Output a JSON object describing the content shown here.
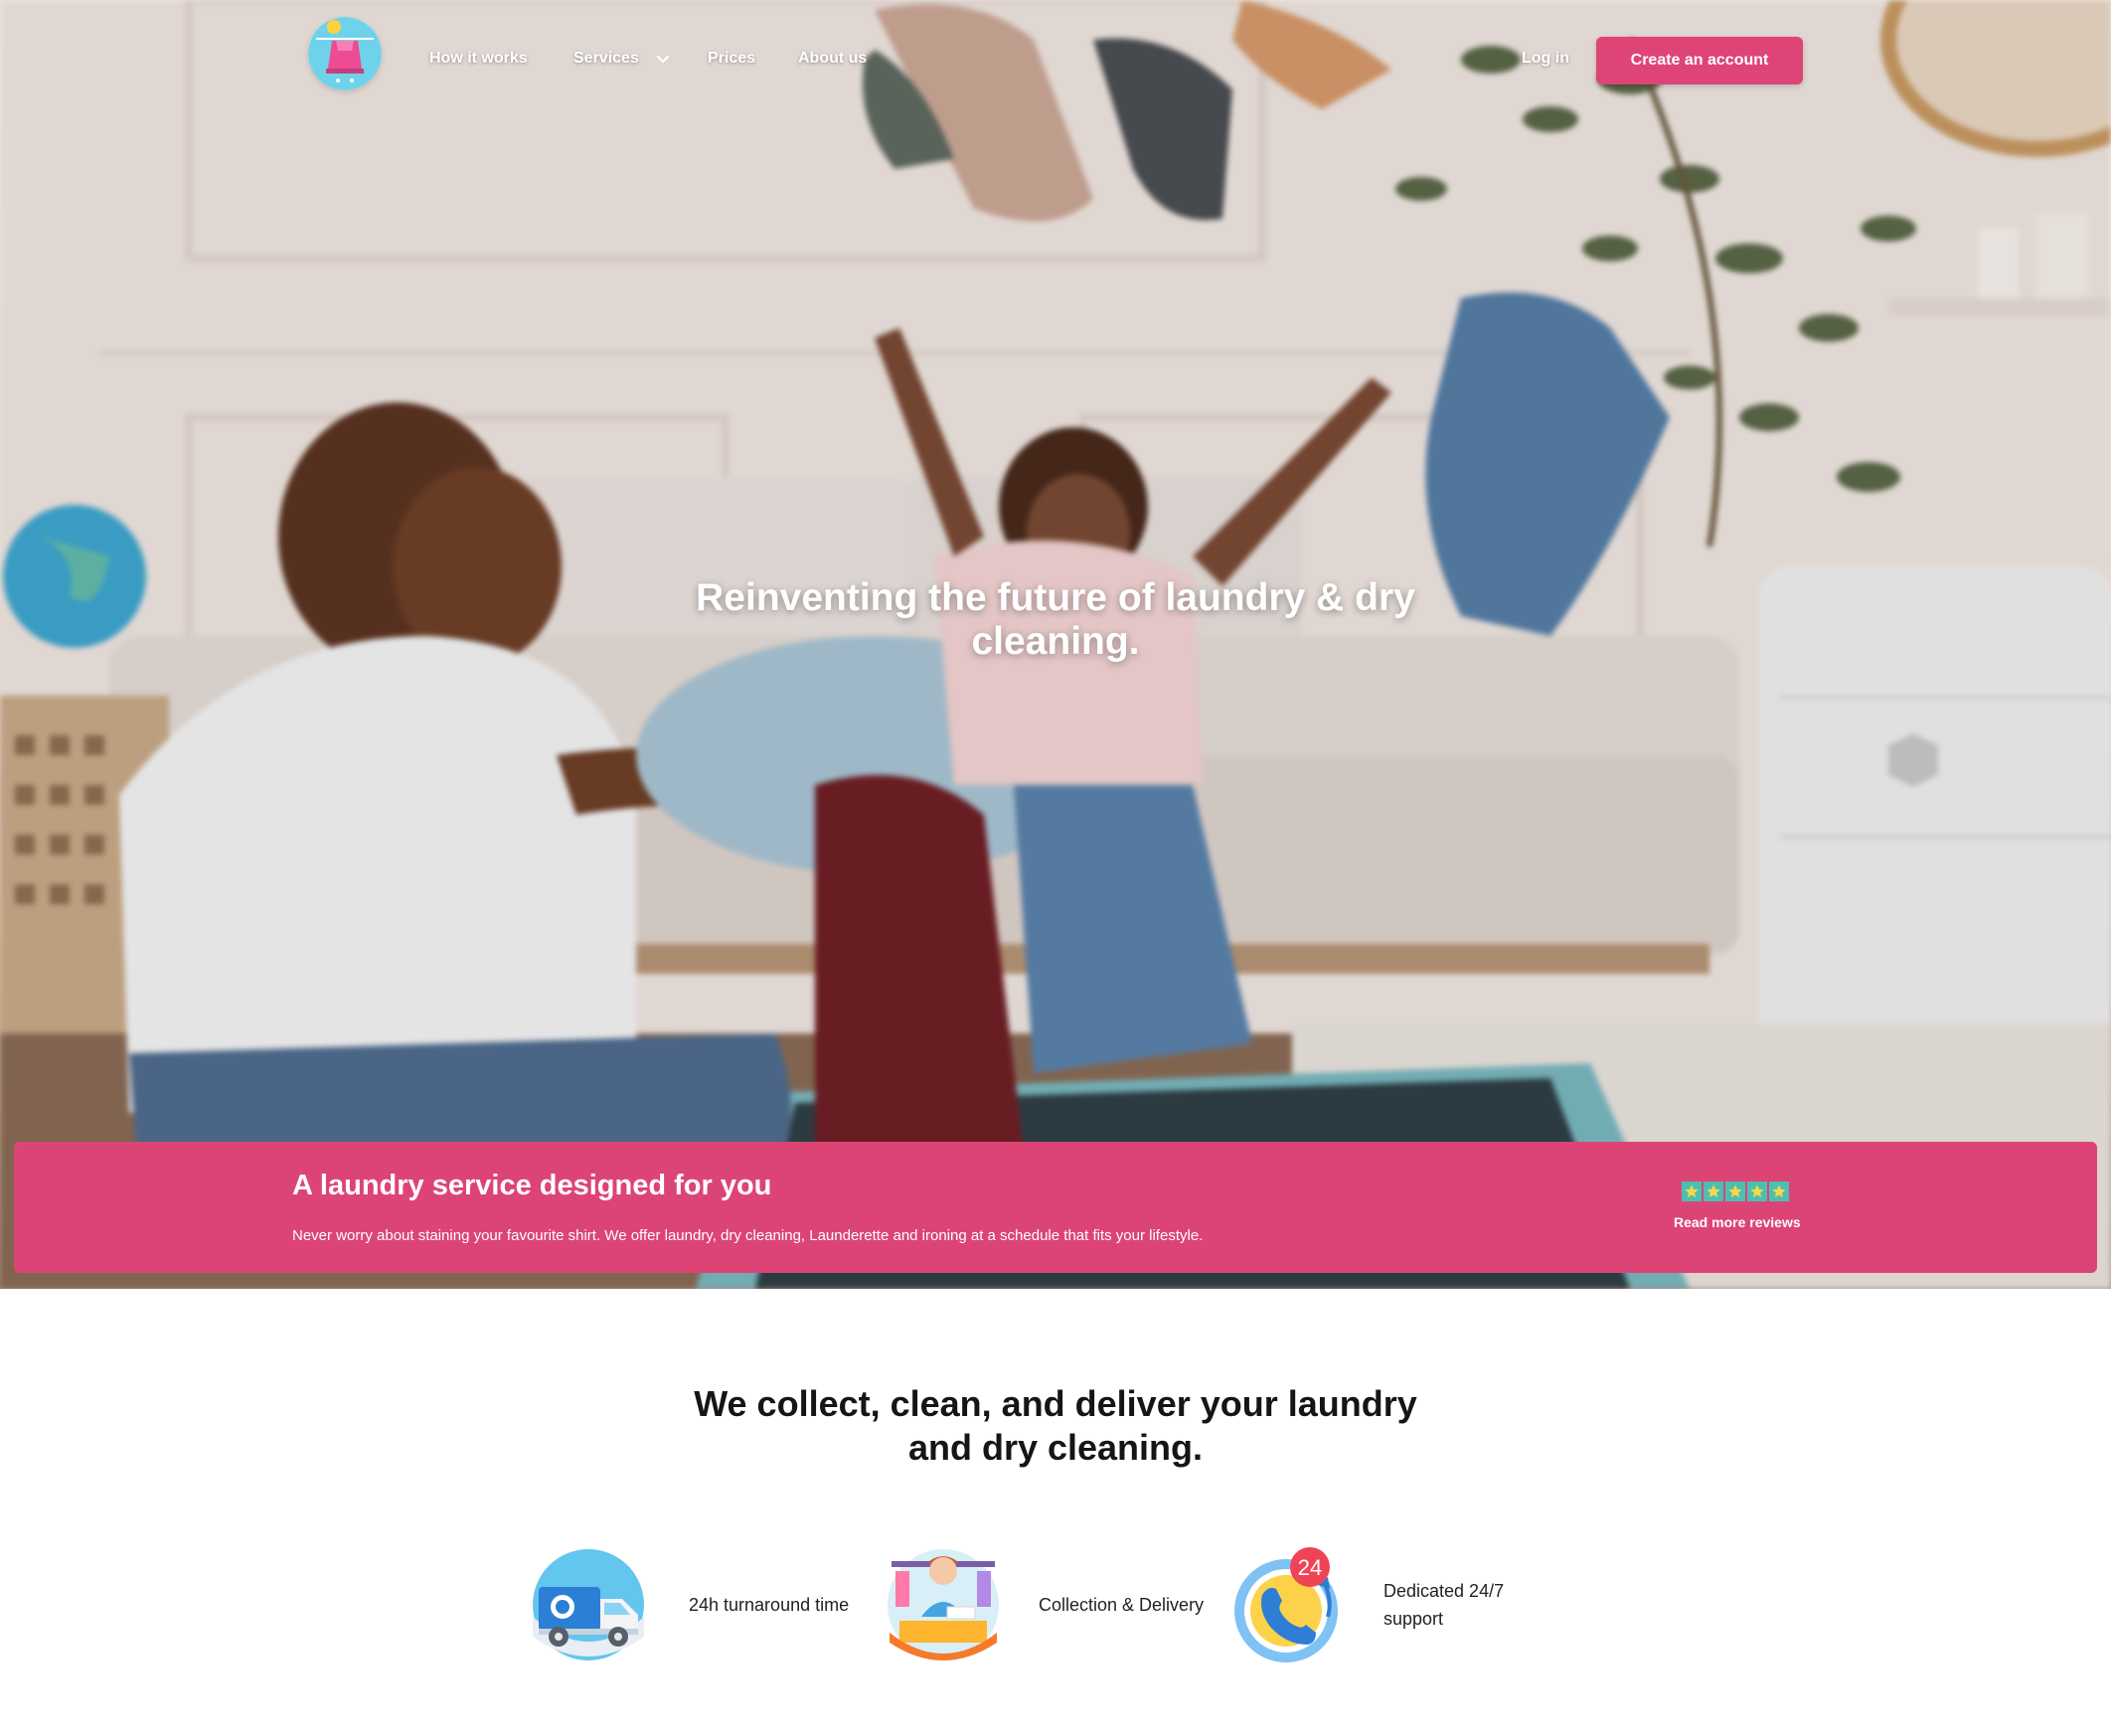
{
  "nav": {
    "links": [
      "How it works",
      "Services",
      "Prices",
      "About us"
    ],
    "login_label": "Log in",
    "create_account_label": "Create an account"
  },
  "hero": {
    "title": "Reinventing the future of laundry & dry cleaning."
  },
  "banner": {
    "title": "A laundry service designed for you",
    "text": "Never worry about staining your favourite shirt. We offer laundry, dry cleaning, Launderette and ironing at a schedule that fits your lifestyle.",
    "rating_stars": 5,
    "reviews_link": "Read more reviews"
  },
  "features": {
    "title": "We collect, clean, and deliver your laundry and dry cleaning.",
    "items": [
      {
        "icon": "delivery-van-icon",
        "label": "24h turnaround time"
      },
      {
        "icon": "laundry-attendant-icon",
        "label": "Collection & Delivery"
      },
      {
        "icon": "phone-support-24-icon",
        "label": "Dedicated 24/7 support",
        "badge": "24"
      }
    ]
  },
  "colors": {
    "accent": "#dd4476",
    "star_box": "#4cbfb2",
    "star": "#f7d84a"
  }
}
